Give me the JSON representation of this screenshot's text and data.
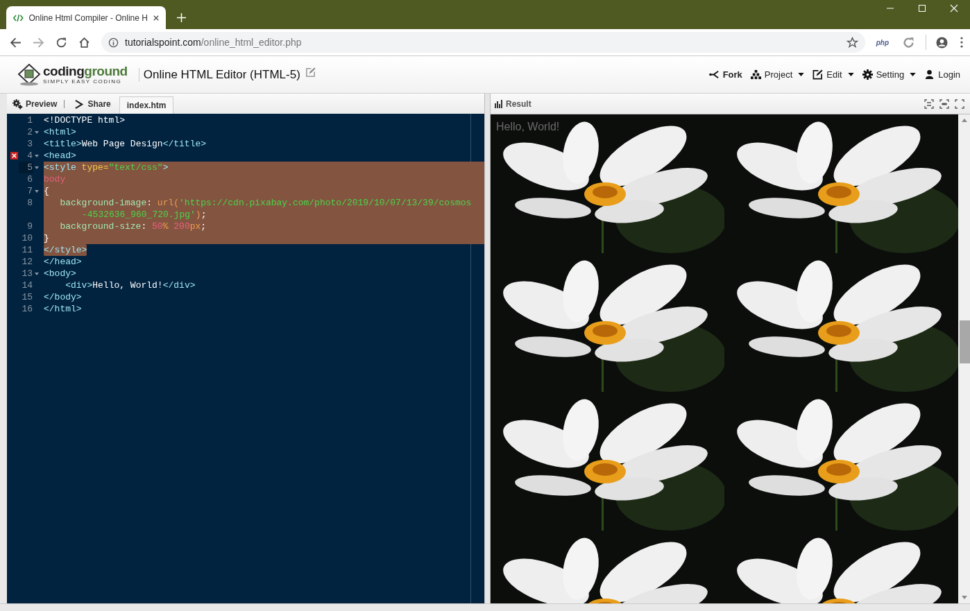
{
  "browser": {
    "tab_title": "Online Html Compiler - Online H",
    "url_domain": "tutorialspoint.com",
    "url_path": "/online_html_editor.php",
    "extension_label": "php"
  },
  "header": {
    "logo_first": "coding",
    "logo_second": "ground",
    "tagline": "SIMPLY EASY CODING",
    "title": "Online HTML Editor (HTML-5)",
    "menu": [
      {
        "label": "Fork",
        "kind": "fork",
        "dropdown": false,
        "bold": true
      },
      {
        "label": "Project",
        "kind": "project",
        "dropdown": true,
        "bold": false
      },
      {
        "label": "Edit",
        "kind": "edit",
        "dropdown": true,
        "bold": false
      },
      {
        "label": "Setting",
        "kind": "setting",
        "dropdown": true,
        "bold": false
      },
      {
        "label": "Login",
        "kind": "login",
        "dropdown": false,
        "bold": false
      }
    ]
  },
  "editor_toolbar": {
    "buttons": [
      {
        "label": "Preview",
        "kind": "preview"
      },
      {
        "label": "Share",
        "kind": "share"
      }
    ],
    "tabs": [
      {
        "label": "index.htm",
        "selected": true
      }
    ]
  },
  "result_panel": {
    "title": "Result",
    "output_text": "Hello, World!"
  },
  "code_lines": [
    {
      "number": "1",
      "fold": false,
      "error": false,
      "active": false,
      "selected": false,
      "partly_selected": false,
      "text": "<!DOCTYPE html>"
    },
    {
      "number": "2",
      "fold": true,
      "error": false,
      "active": false,
      "selected": false,
      "partly_selected": false,
      "text": "<html>"
    },
    {
      "number": "3",
      "fold": false,
      "error": false,
      "active": false,
      "selected": false,
      "partly_selected": false,
      "text": "<title>Web Page Design</title>"
    },
    {
      "number": "4",
      "fold": true,
      "error": true,
      "active": false,
      "selected": false,
      "partly_selected": false,
      "text": "<head>"
    },
    {
      "number": "5",
      "fold": true,
      "error": false,
      "active": true,
      "selected": true,
      "partly_selected": false,
      "text": "<style type=\"text/css\">"
    },
    {
      "number": "6",
      "fold": false,
      "error": false,
      "active": false,
      "selected": true,
      "partly_selected": false,
      "text": "body"
    },
    {
      "number": "7",
      "fold": true,
      "error": false,
      "active": false,
      "selected": true,
      "partly_selected": false,
      "text": "{"
    },
    {
      "number": "8",
      "fold": false,
      "error": false,
      "active": false,
      "selected": true,
      "partly_selected": false,
      "text": "   background-image: url('https://cdn.pixabay.com/photo/2019/10/07/13/39/cosmos",
      "wrap": "-4532636_960_720.jpg');"
    },
    {
      "number": "9",
      "fold": false,
      "error": false,
      "active": false,
      "selected": true,
      "partly_selected": false,
      "text": "   background-size: 50% 200px;"
    },
    {
      "number": "10",
      "fold": false,
      "error": false,
      "active": false,
      "selected": true,
      "partly_selected": false,
      "text": "}"
    },
    {
      "number": "11",
      "fold": false,
      "error": false,
      "active": false,
      "selected": false,
      "partly_selected": true,
      "text": "</style>"
    },
    {
      "number": "12",
      "fold": false,
      "error": false,
      "active": false,
      "selected": false,
      "partly_selected": false,
      "text": "</head>"
    },
    {
      "number": "13",
      "fold": true,
      "error": false,
      "active": false,
      "selected": false,
      "partly_selected": false,
      "text": "<body>"
    },
    {
      "number": "14",
      "fold": false,
      "error": false,
      "active": false,
      "selected": false,
      "partly_selected": false,
      "text": "    <div>Hello, World!</div>"
    },
    {
      "number": "15",
      "fold": false,
      "error": false,
      "active": false,
      "selected": false,
      "partly_selected": false,
      "text": "</body>"
    },
    {
      "number": "16",
      "fold": false,
      "error": false,
      "active": false,
      "selected": false,
      "partly_selected": false,
      "text": "</html>"
    }
  ]
}
